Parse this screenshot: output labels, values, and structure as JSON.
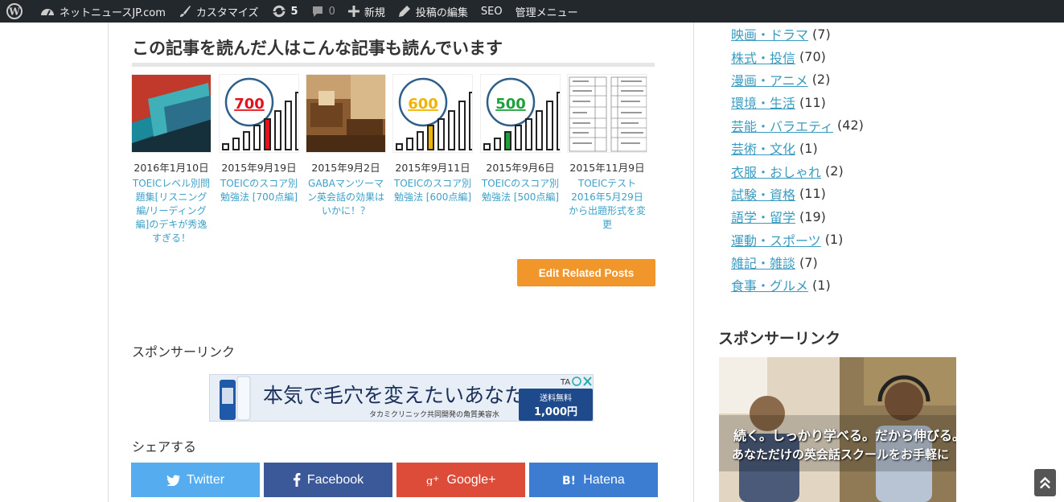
{
  "adminbar": {
    "site_name": "ネットニュースJP.com",
    "customize": "カスタマイズ",
    "updates_count": "5",
    "comments_count": "0",
    "new": "新規",
    "edit_post": "投稿の編集",
    "seo": "SEO",
    "admin_menu": "管理メニュー"
  },
  "related": {
    "heading": "この記事を読んだ人はこんな記事も読んでいます",
    "items": [
      {
        "date": "2016年1月10日",
        "title": "TOEICレベル別問題集[リスニング編/リーディング編]のデキが秀逸すぎる！"
      },
      {
        "date": "2015年9月19日",
        "title": "TOEICのスコア別勉強法 [700点編]",
        "score": "700",
        "score_color": "#e0141e"
      },
      {
        "date": "2015年9月2日",
        "title": "GABAマンツーマン英会話の効果はいかに！？"
      },
      {
        "date": "2015年9月11日",
        "title": "TOEICのスコア別勉強法 [600点編]",
        "score": "600",
        "score_color": "#f0b400"
      },
      {
        "date": "2015年9月6日",
        "title": "TOEICのスコア別勉強法 [500点編]",
        "score": "500",
        "score_color": "#1ea03c"
      },
      {
        "date": "2015年11月9日",
        "title": "TOEICテスト2016年5月29日から出題形式を変更"
      }
    ],
    "edit_button": "Edit Related Posts"
  },
  "main": {
    "sponsor_label": "スポンサーリンク",
    "ad": {
      "headline": "本気で毛穴を変えたいあなたへ",
      "sub": "タカミクリニック共同開発の角質美容水",
      "badge_top": "送料無料",
      "badge_price": "1,000円"
    },
    "share_label": "シェアする",
    "share": [
      {
        "label": "Twitter",
        "color": "#55acee"
      },
      {
        "label": "Facebook",
        "color": "#3b5998"
      },
      {
        "label": "Google+",
        "color": "#dd4b39"
      },
      {
        "label": "Hatena",
        "color": "#3c7dd1"
      }
    ]
  },
  "sidebar": {
    "categories": [
      {
        "name": "映画・ドラマ",
        "count": "(7)"
      },
      {
        "name": "株式・投信",
        "count": "(70)"
      },
      {
        "name": "漫画・アニメ",
        "count": "(2)"
      },
      {
        "name": "環境・生活",
        "count": "(11)"
      },
      {
        "name": "芸能・バラエティ",
        "count": "(42)"
      },
      {
        "name": "芸術・文化",
        "count": "(1)"
      },
      {
        "name": "衣服・おしゃれ",
        "count": "(2)"
      },
      {
        "name": "試験・資格",
        "count": "(11)"
      },
      {
        "name": "語学・留学",
        "count": "(19)"
      },
      {
        "name": "運動・スポーツ",
        "count": "(1)"
      },
      {
        "name": "雑記・雑談",
        "count": "(7)"
      },
      {
        "name": "食事・グルメ",
        "count": "(1)"
      }
    ],
    "sponsor_label": "スポンサーリンク",
    "ad_line1": "続く。しっかり学べる。だから伸びる。",
    "ad_line2": "あなただけの英会話スクールをお手軽に"
  }
}
